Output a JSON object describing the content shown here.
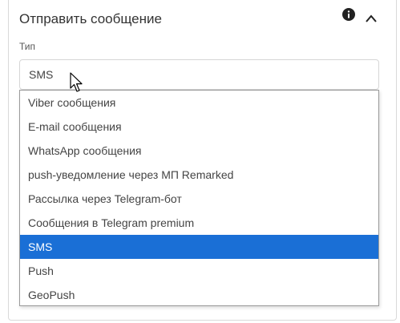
{
  "panel": {
    "title": "Отправить сообщение",
    "info_icon": "info-icon",
    "collapse_icon": "chevron-up-icon"
  },
  "field": {
    "label": "Тип",
    "value": "SMS"
  },
  "dropdown": {
    "options": [
      "Viber сообщения",
      "E-mail сообщения",
      "WhatsApp сообщения",
      "push-уведомление через МП Remarked",
      "Рассылка через Telegram-бот",
      "Сообщения в Telegram premium",
      "SMS",
      "Push",
      "GeoPush"
    ],
    "selected": "SMS"
  },
  "colors": {
    "selected_bg": "#1a6fd6",
    "selected_text": "#ffffff",
    "text": "#444444",
    "border": "#d6d6d6"
  }
}
